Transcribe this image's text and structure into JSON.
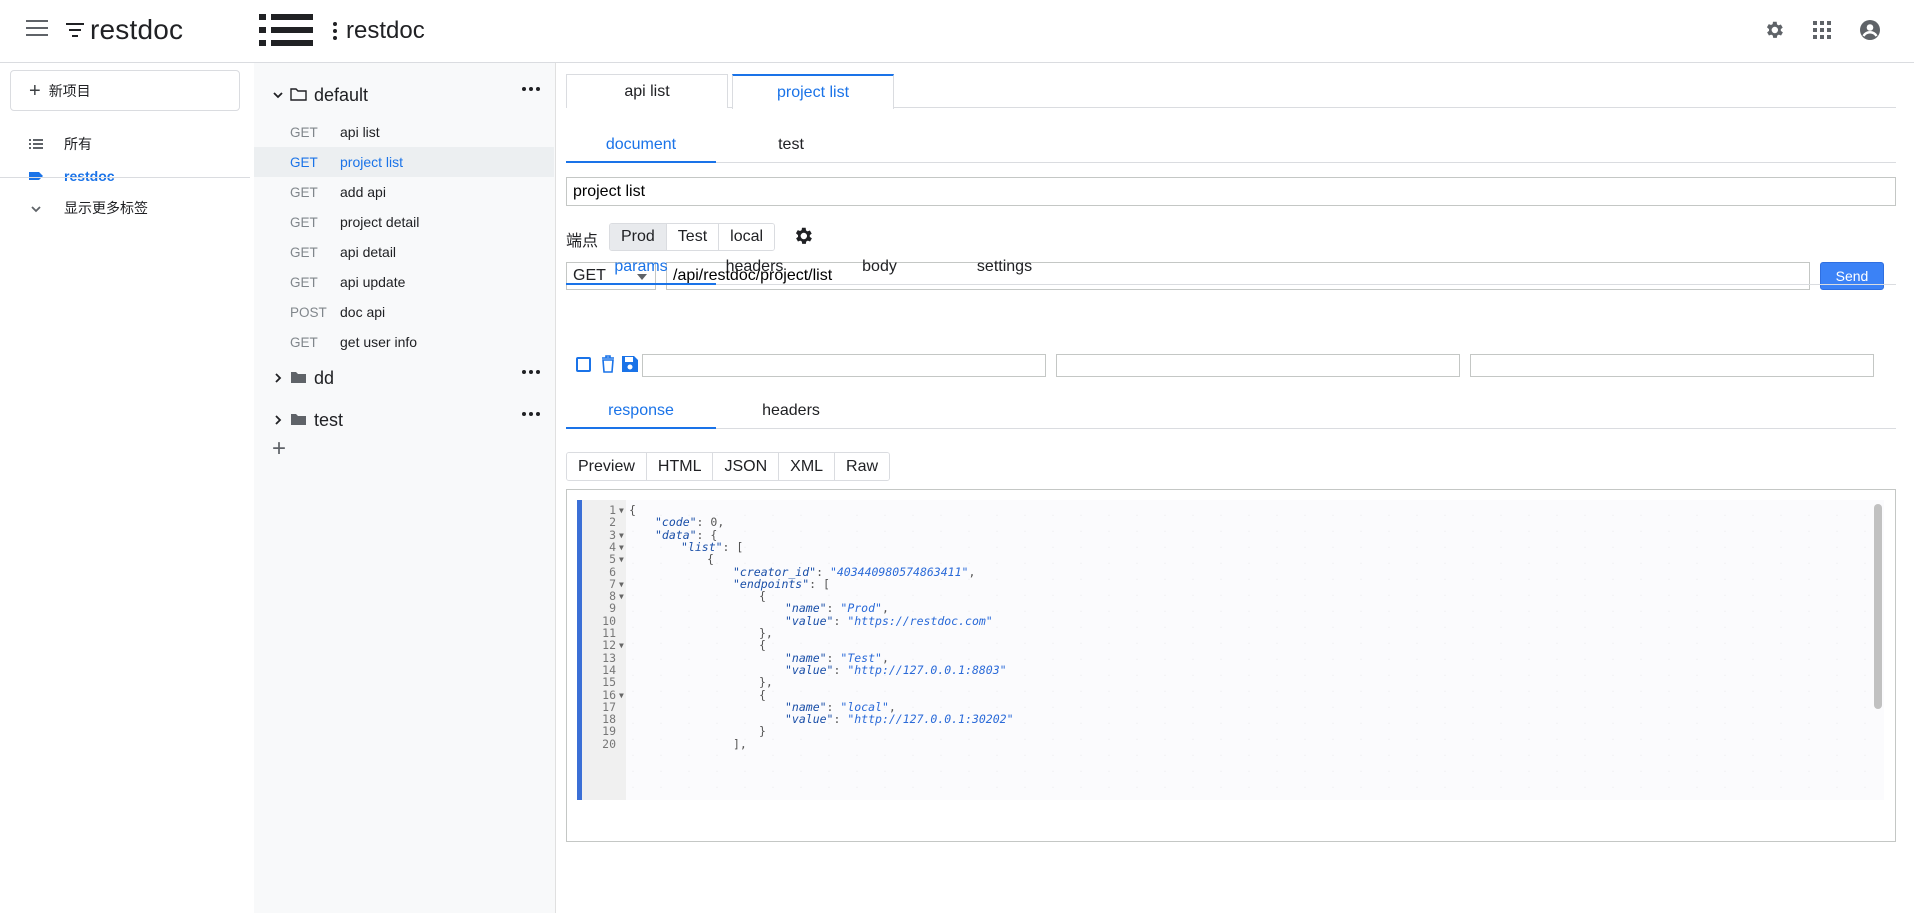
{
  "app": {
    "brand": "restdoc",
    "project_title": "restdoc"
  },
  "sidebar": {
    "new_project": "新项目",
    "items": [
      {
        "label": "所有",
        "icon": "list-icon"
      },
      {
        "label": "restdoc",
        "icon": "label-icon",
        "active": true
      },
      {
        "label": "显示更多标签",
        "icon": "chevron-down-icon"
      }
    ]
  },
  "tree": {
    "folders": [
      {
        "name": "default",
        "expanded": true,
        "apis": [
          {
            "method": "GET",
            "name": "api list"
          },
          {
            "method": "GET",
            "name": "project list",
            "selected": true
          },
          {
            "method": "GET",
            "name": "add api"
          },
          {
            "method": "GET",
            "name": "project detail"
          },
          {
            "method": "GET",
            "name": "api detail"
          },
          {
            "method": "GET",
            "name": "api update"
          },
          {
            "method": "POST",
            "name": "doc api"
          },
          {
            "method": "GET",
            "name": "get user info"
          }
        ]
      },
      {
        "name": "dd",
        "expanded": false
      },
      {
        "name": "test",
        "expanded": false
      }
    ],
    "add_label": "+"
  },
  "tabs": [
    {
      "label": "api list",
      "active": false
    },
    {
      "label": "project list",
      "active": true
    }
  ],
  "doc_tabs": [
    {
      "label": "document",
      "active": true
    },
    {
      "label": "test",
      "active": false
    }
  ],
  "request": {
    "name": "project list",
    "endpoint_label": "端点",
    "endpoints": [
      {
        "label": "Prod",
        "active": true
      },
      {
        "label": "Test",
        "active": false
      },
      {
        "label": "local",
        "active": false
      }
    ],
    "method": "GET",
    "url": "/api/restdoc/project/list",
    "send_label": "Send"
  },
  "request_tabs": [
    {
      "label": "params",
      "active": true
    },
    {
      "label": "headers",
      "active": false
    },
    {
      "label": "body",
      "active": false
    },
    {
      "label": "settings",
      "active": false
    }
  ],
  "response_tabs": [
    {
      "label": "response",
      "active": true
    },
    {
      "label": "headers",
      "active": false
    }
  ],
  "formats": [
    "Preview",
    "HTML",
    "JSON",
    "XML",
    "Raw"
  ],
  "colors": {
    "accent": "#1a73e8",
    "send": "#3b82f6",
    "gutter_bar": "#3b6fd6"
  },
  "code_lines": [
    {
      "n": "1",
      "fold": true,
      "indent": 0,
      "parts": [
        {
          "t": "n",
          "v": "{"
        }
      ]
    },
    {
      "n": "2",
      "fold": false,
      "indent": 1,
      "parts": [
        {
          "t": "k",
          "v": "\"code\""
        },
        {
          "t": "n",
          "v": ": 0,"
        }
      ]
    },
    {
      "n": "3",
      "fold": true,
      "indent": 1,
      "parts": [
        {
          "t": "k",
          "v": "\"data\""
        },
        {
          "t": "n",
          "v": ": {"
        }
      ]
    },
    {
      "n": "4",
      "fold": true,
      "indent": 2,
      "parts": [
        {
          "t": "k",
          "v": "\"list\""
        },
        {
          "t": "n",
          "v": ": ["
        }
      ]
    },
    {
      "n": "5",
      "fold": true,
      "indent": 3,
      "parts": [
        {
          "t": "n",
          "v": "{"
        }
      ]
    },
    {
      "n": "6",
      "fold": false,
      "indent": 4,
      "parts": [
        {
          "t": "k",
          "v": "\"creator_id\""
        },
        {
          "t": "n",
          "v": ": "
        },
        {
          "t": "s",
          "v": "\"403440980574863411\""
        },
        {
          "t": "n",
          "v": ","
        }
      ]
    },
    {
      "n": "7",
      "fold": true,
      "indent": 4,
      "parts": [
        {
          "t": "k",
          "v": "\"endpoints\""
        },
        {
          "t": "n",
          "v": ": ["
        }
      ]
    },
    {
      "n": "8",
      "fold": true,
      "indent": 5,
      "parts": [
        {
          "t": "n",
          "v": "{"
        }
      ]
    },
    {
      "n": "9",
      "fold": false,
      "indent": 6,
      "parts": [
        {
          "t": "k",
          "v": "\"name\""
        },
        {
          "t": "n",
          "v": ": "
        },
        {
          "t": "s",
          "v": "\"Prod\""
        },
        {
          "t": "n",
          "v": ","
        }
      ]
    },
    {
      "n": "10",
      "fold": false,
      "indent": 6,
      "parts": [
        {
          "t": "k",
          "v": "\"value\""
        },
        {
          "t": "n",
          "v": ": "
        },
        {
          "t": "s",
          "v": "\"https://restdoc.com\""
        }
      ]
    },
    {
      "n": "11",
      "fold": false,
      "indent": 5,
      "parts": [
        {
          "t": "n",
          "v": "},"
        }
      ]
    },
    {
      "n": "12",
      "fold": true,
      "indent": 5,
      "parts": [
        {
          "t": "n",
          "v": "{"
        }
      ]
    },
    {
      "n": "13",
      "fold": false,
      "indent": 6,
      "parts": [
        {
          "t": "k",
          "v": "\"name\""
        },
        {
          "t": "n",
          "v": ": "
        },
        {
          "t": "s",
          "v": "\"Test\""
        },
        {
          "t": "n",
          "v": ","
        }
      ]
    },
    {
      "n": "14",
      "fold": false,
      "indent": 6,
      "parts": [
        {
          "t": "k",
          "v": "\"value\""
        },
        {
          "t": "n",
          "v": ": "
        },
        {
          "t": "s",
          "v": "\"http://127.0.0.1:8803\""
        }
      ]
    },
    {
      "n": "15",
      "fold": false,
      "indent": 5,
      "parts": [
        {
          "t": "n",
          "v": "},"
        }
      ]
    },
    {
      "n": "16",
      "fold": true,
      "indent": 5,
      "parts": [
        {
          "t": "n",
          "v": "{"
        }
      ]
    },
    {
      "n": "17",
      "fold": false,
      "indent": 6,
      "parts": [
        {
          "t": "k",
          "v": "\"name\""
        },
        {
          "t": "n",
          "v": ": "
        },
        {
          "t": "s",
          "v": "\"local\""
        },
        {
          "t": "n",
          "v": ","
        }
      ]
    },
    {
      "n": "18",
      "fold": false,
      "indent": 6,
      "parts": [
        {
          "t": "k",
          "v": "\"value\""
        },
        {
          "t": "n",
          "v": ": "
        },
        {
          "t": "s",
          "v": "\"http://127.0.0.1:30202\""
        }
      ]
    },
    {
      "n": "19",
      "fold": false,
      "indent": 5,
      "parts": [
        {
          "t": "n",
          "v": "}"
        }
      ]
    },
    {
      "n": "20",
      "fold": false,
      "indent": 4,
      "parts": [
        {
          "t": "n",
          "v": "],"
        }
      ]
    }
  ]
}
